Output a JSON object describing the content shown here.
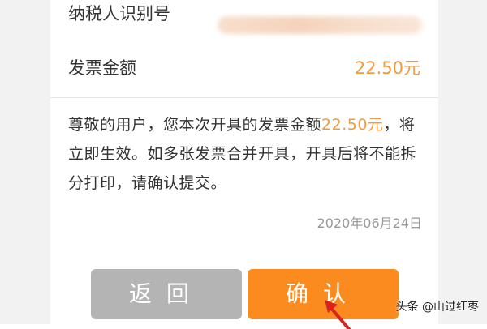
{
  "invoice": {
    "tax_id_label": "纳税人识别号",
    "amount_label": "发票金额",
    "amount_value": "22.50元"
  },
  "notice": {
    "text_before": "尊敬的用户，您本次开具的发票金额",
    "highlight": "22.50元",
    "text_after": "，将立即生效。如多张发票合并开具，开具后将不能拆分打印，请确认提交。"
  },
  "date": "2020年06月24日",
  "buttons": {
    "back_label": "返回",
    "confirm_label": "确认"
  },
  "watermark": "头条 @山过红枣",
  "colors": {
    "accent": "#fb8b1e",
    "amount_text": "#f19a3e",
    "back_button": "#b4b4b4",
    "arrow": "#d9231c"
  }
}
